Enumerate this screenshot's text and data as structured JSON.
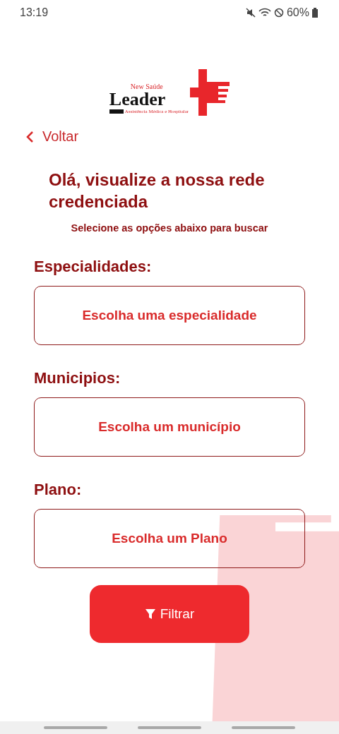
{
  "status_bar": {
    "time": "13:19",
    "battery": "60%"
  },
  "logo": {
    "tagline": "New Saúde",
    "name": "Leader",
    "subtitle": "Assistência Médica e Hospitalar"
  },
  "back_link": "Voltar",
  "title": "Olá, visualize a nossa rede credenciada",
  "subtitle": "Selecione as opções abaixo para buscar",
  "fields": [
    {
      "label": "Especialidades:",
      "placeholder": "Escolha uma especialidade"
    },
    {
      "label": "Municipios:",
      "placeholder": "Escolha um município"
    },
    {
      "label": "Plano:",
      "placeholder": "Escolha um Plano"
    }
  ],
  "filter_button": "Filtrar"
}
